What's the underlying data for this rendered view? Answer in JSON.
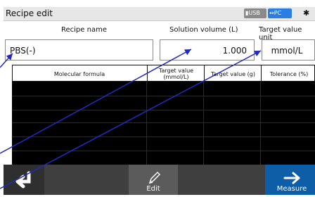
{
  "window": {
    "title": "Recipe edit"
  },
  "status": {
    "usb": "USB",
    "pc": "PC",
    "bluetooth_icon": "bluetooth-icon"
  },
  "form": {
    "recipe_name_label": "Recipe name",
    "solution_volume_label": "Solution volume (L)",
    "target_value_unit_label": "Target value unit",
    "recipe_name_value": "PBS(-)",
    "solution_volume_value": "1.000",
    "target_value_unit_value": "mmol/L"
  },
  "table": {
    "columns": [
      "Molecular formula",
      "Target value\n(mmol/L)",
      "Target value (g)",
      "Tolerance (%)"
    ],
    "rows": [
      [
        "",
        "",
        "",
        ""
      ],
      [
        "",
        "",
        "",
        ""
      ],
      [
        "",
        "",
        "",
        ""
      ],
      [
        "",
        "",
        "",
        ""
      ],
      [
        "",
        "",
        "",
        ""
      ],
      [
        "",
        "",
        "",
        ""
      ]
    ]
  },
  "toolbar": {
    "back_icon": "back-arrow-icon",
    "edit_label": "Edit",
    "edit_icon": "pencil-icon",
    "measure_label": "Measure",
    "measure_icon": "right-arrow-icon"
  },
  "colors": {
    "accent": "#0e5ea7",
    "annotation": "#1f2bbf"
  }
}
